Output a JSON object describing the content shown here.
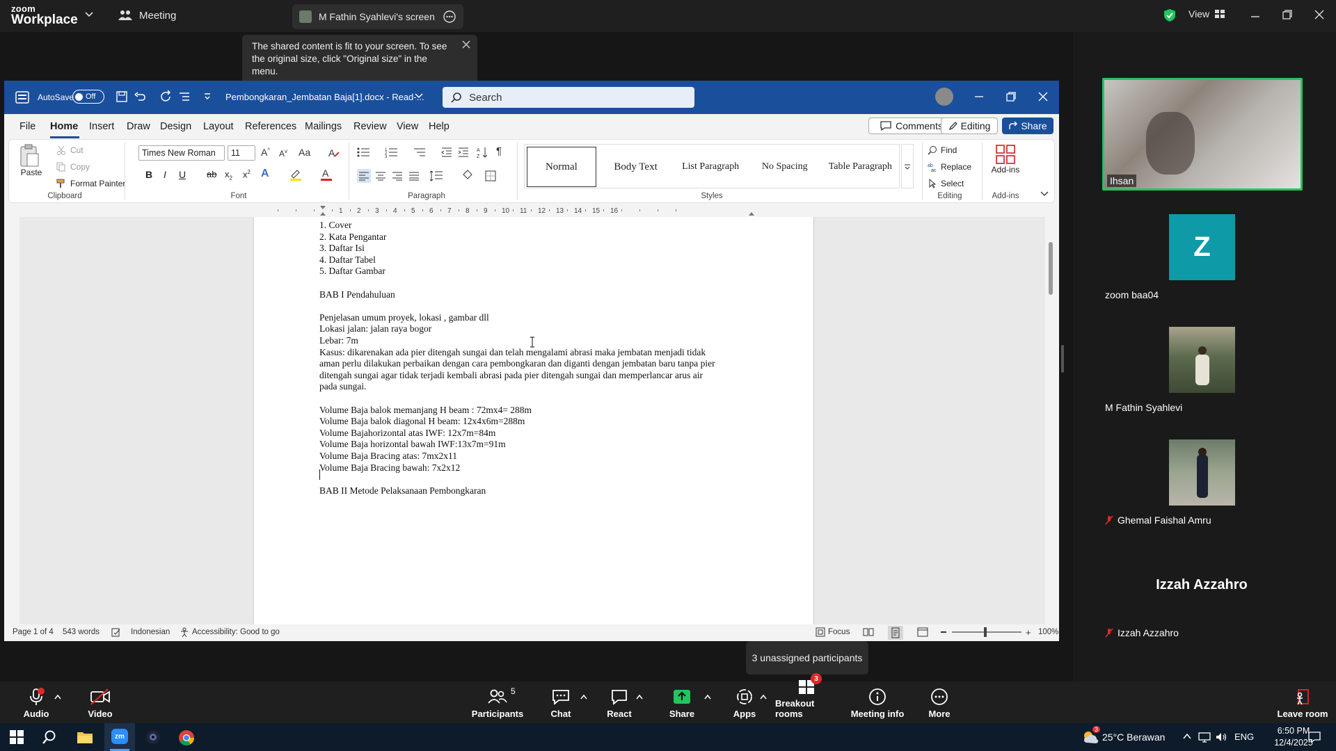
{
  "zoom_top": {
    "brand_small": "zoom",
    "brand_big": "Workplace",
    "meeting_label": "Meeting",
    "screen_tab_label": "M Fathin Syahlevi's screen",
    "view_label": "View"
  },
  "tooltip": {
    "text": "The shared content is fit to your screen. To see the original size, click \"Original size\" in the menu."
  },
  "word": {
    "autosave_label": "AutoSave",
    "autosave_state": "Off",
    "doc_title": "Pembongkaran_Jembatan Baja[1].docx  -  Read-...",
    "search_placeholder": "Search",
    "menu": [
      "File",
      "Home",
      "Insert",
      "Draw",
      "Design",
      "Layout",
      "References",
      "Mailings",
      "Review",
      "View",
      "Help"
    ],
    "comments_label": "Comments",
    "editing_label": "Editing",
    "share_label": "Share",
    "ribbon": {
      "paste": "Paste",
      "cut": "Cut",
      "copy": "Copy",
      "format_painter": "Format Painter",
      "clipboard": "Clipboard",
      "font_name": "Times New Roman",
      "font_size": "11",
      "font": "Font",
      "paragraph": "Paragraph",
      "styles_group": "Styles",
      "styles": [
        "Normal",
        "Body Text",
        "List Paragraph",
        "No Spacing",
        "Table Paragraph"
      ],
      "find": "Find",
      "replace": "Replace",
      "select": "Select",
      "editing": "Editing",
      "addins": "Add-ins",
      "addins_group": "Add-ins"
    },
    "ruler_numbers": [
      "1",
      "2",
      "3",
      "4",
      "5",
      "6",
      "7",
      "8",
      "9",
      "10",
      "11",
      "12",
      "13",
      "14",
      "15",
      "16"
    ],
    "doc_lines": [
      "1. Cover",
      "2. Kata Pengantar",
      "3. Daftar Isi",
      "4. Daftar Tabel",
      "5. Daftar Gambar",
      "",
      "BAB I Pendahuluan",
      "",
      "Penjelasan umum proyek, lokasi , gambar dll",
      "Lokasi jalan: jalan raya bogor",
      "Lebar: 7m",
      "Kasus: dikarenakan ada pier ditengah sungai dan telah mengalami abrasi maka jembatan menjadi tidak",
      "aman perlu dilakukan perbaikan dengan cara pembongkaran dan diganti dengan jembatan baru tanpa pier",
      "ditengah sungai agar tidak terjadi kembali abrasi pada pier ditengah sungai dan memperlancar arus air",
      "pada sungai.",
      "",
      "Volume Baja balok memanjang H beam : 72mx4= 288m",
      "Volume Baja balok diagonal H beam: 12x4x6m=288m",
      "Volume Bajahorizontal atas IWF: 12x7m=84m",
      "Volume Baja horizontal bawah IWF:13x7m=91m",
      "Volume Baja Bracing atas: 7mx2x11",
      "Volume Baja Bracing bawah: 7x2x12",
      "",
      "BAB II Metode Pelaksanaan Pembongkaran"
    ],
    "status": {
      "page": "Page 1 of 4",
      "words": "543 words",
      "language": "Indonesian",
      "accessibility": "Accessibility: Good to go",
      "focus": "Focus",
      "zoom": "100%"
    }
  },
  "participants": [
    {
      "name": "Ihsan",
      "muted": false
    },
    {
      "name": "zoom baa04",
      "initial": "Z",
      "muted": false
    },
    {
      "name": "M Fathin Syahlevi",
      "muted": false
    },
    {
      "name": "Ghemal Faishal Amru",
      "muted": true
    },
    {
      "name": "Izzah Azzahro",
      "display": "Izzah Azzahro",
      "muted": true
    }
  ],
  "unassigned_toast": "3 unassigned participants",
  "toolbar": {
    "audio": "Audio",
    "video": "Video",
    "participants": "Participants",
    "participants_count": "5",
    "chat": "Chat",
    "react": "React",
    "share": "Share",
    "apps": "Apps",
    "breakout": "Breakout rooms",
    "breakout_badge": "3",
    "meeting_info": "Meeting info",
    "more": "More",
    "leave": "Leave room"
  },
  "taskbar": {
    "weather_badge": "3",
    "weather": "25°C  Berawan",
    "lang": "ENG",
    "time": "6:50 PM",
    "date": "12/4/2025"
  },
  "colors": {
    "word_blue": "#1a4f9c",
    "zoom_green": "#22c55e",
    "zoom_red": "#e02828",
    "avatar_teal": "#0e9aa7",
    "active_speaker": "#22c55e"
  }
}
